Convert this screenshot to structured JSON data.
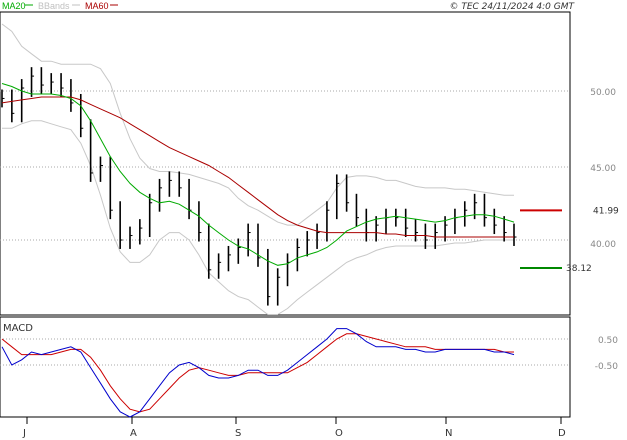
{
  "legend": {
    "ma20": "MA20",
    "bbands": "BBands",
    "ma60": "MA60"
  },
  "copyright": "© TEC 24/11/2024 4:0 GMT",
  "macd_label": "MACD",
  "colors": {
    "ma20": "#00aa00",
    "ma60": "#aa0000",
    "bbands": "#c8c8c8",
    "macd": "#0000cc",
    "signal": "#cc0000",
    "bars": "#000000",
    "resistance": "#cc0000",
    "support": "#008800"
  },
  "chart_data": [
    {
      "type": "line",
      "title": "",
      "price_axis_labels": [
        "50.00",
        "45.00",
        "40.00"
      ],
      "month_labels": [
        "J",
        "A",
        "S",
        "O",
        "N",
        "D"
      ],
      "ylim": [
        34,
        55
      ],
      "levels": {
        "resistance": {
          "label": "41.99",
          "value": 41.99
        },
        "support": {
          "label": "38.12",
          "value": 38.12
        }
      },
      "dates_index": [
        0,
        2,
        4,
        6,
        8,
        10,
        12,
        14,
        16,
        18,
        20,
        22,
        24,
        26,
        28,
        30,
        32,
        34,
        36,
        38,
        40,
        42,
        44,
        46,
        48,
        50,
        52,
        54,
        56,
        58,
        60,
        62,
        64,
        66,
        68,
        70,
        72,
        74,
        76,
        78,
        80,
        82,
        84,
        86,
        88,
        90,
        92,
        94,
        96,
        98,
        100,
        102,
        104
      ],
      "price": [
        49.5,
        48.5,
        50.2,
        51.0,
        50.4,
        50.6,
        50.2,
        49.2,
        47.5,
        44.5,
        45.0,
        42.0,
        40.0,
        40.3,
        40.8,
        42.5,
        43.5,
        44.0,
        43.5,
        42.0,
        40.5,
        38.0,
        38.5,
        39.0,
        39.5,
        40.5,
        38.8,
        36.2,
        37.5,
        38.5,
        39.5,
        40.0,
        40.5,
        42.0,
        43.8,
        42.5,
        41.5,
        40.5,
        41.0,
        41.5,
        41.5,
        40.8,
        40.5,
        40.0,
        40.5,
        41.0,
        41.5,
        42.0,
        42.5,
        41.5,
        41.0,
        40.5,
        40.2
      ],
      "ma20": [
        50.5,
        50.3,
        50.0,
        49.8,
        49.8,
        49.8,
        49.7,
        49.5,
        49.0,
        48.0,
        46.8,
        45.6,
        44.6,
        43.8,
        43.2,
        42.8,
        42.5,
        42.6,
        42.4,
        42.0,
        41.6,
        41.0,
        40.5,
        40.0,
        39.6,
        39.4,
        39.0,
        38.6,
        38.3,
        38.4,
        38.8,
        39.0,
        39.2,
        39.5,
        40.0,
        40.6,
        40.9,
        41.2,
        41.4,
        41.5,
        41.6,
        41.5,
        41.4,
        41.3,
        41.2,
        41.3,
        41.5,
        41.6,
        41.7,
        41.7,
        41.6,
        41.4,
        41.2
      ],
      "ma60": [
        49.2,
        49.3,
        49.4,
        49.5,
        49.6,
        49.6,
        49.6,
        49.6,
        49.4,
        49.1,
        48.8,
        48.5,
        48.2,
        47.8,
        47.4,
        47.0,
        46.6,
        46.2,
        45.9,
        45.6,
        45.3,
        45.0,
        44.6,
        44.2,
        43.7,
        43.2,
        42.7,
        42.2,
        41.7,
        41.3,
        41.0,
        40.8,
        40.6,
        40.5,
        40.5,
        40.5,
        40.5,
        40.5,
        40.5,
        40.4,
        40.4,
        40.3,
        40.3,
        40.3,
        40.2,
        40.2,
        40.2,
        40.2,
        40.2,
        40.2,
        40.2,
        40.2,
        40.2
      ],
      "bb_upper": [
        54.5,
        54.0,
        53.0,
        52.5,
        52.0,
        52.0,
        51.8,
        51.8,
        51.8,
        51.8,
        51.5,
        50.5,
        48.5,
        46.8,
        45.5,
        44.8,
        44.6,
        44.6,
        44.5,
        44.4,
        44.2,
        44.0,
        43.8,
        43.5,
        42.8,
        42.3,
        42.0,
        41.6,
        41.2,
        41.0,
        41.0,
        41.5,
        42.0,
        42.5,
        43.5,
        44.2,
        44.3,
        44.3,
        44.2,
        44.0,
        44.0,
        43.8,
        43.6,
        43.5,
        43.5,
        43.5,
        43.4,
        43.4,
        43.3,
        43.2,
        43.1,
        43.0,
        43.0
      ],
      "bb_lower": [
        47.5,
        47.5,
        47.8,
        48.0,
        48.0,
        47.8,
        47.6,
        47.4,
        46.5,
        45.0,
        43.0,
        40.8,
        39.2,
        38.5,
        38.5,
        39.0,
        40.0,
        40.5,
        40.5,
        40.0,
        39.0,
        37.8,
        37.2,
        36.6,
        36.2,
        36.0,
        35.5,
        35.0,
        35.0,
        35.4,
        36.0,
        36.5,
        37.0,
        37.5,
        38.0,
        38.5,
        38.8,
        39.0,
        39.3,
        39.5,
        39.6,
        39.6,
        39.6,
        39.6,
        39.6,
        39.7,
        39.8,
        39.8,
        39.9,
        40.0,
        40.0,
        40.0,
        40.0
      ]
    },
    {
      "type": "line",
      "title": "MACD",
      "axis_labels": [
        "0.50",
        "-0.50"
      ],
      "ylim": [
        -2.6,
        1.3
      ],
      "series": [
        {
          "name": "",
          "values": [
            0.2,
            -0.5,
            -0.3,
            0.0,
            -0.1,
            0.0,
            0.1,
            0.2,
            0.0,
            -0.6,
            -1.2,
            -1.8,
            -2.3,
            -2.5,
            -2.3,
            -1.8,
            -1.3,
            -0.8,
            -0.5,
            -0.4,
            -0.6,
            -0.9,
            -1.0,
            -1.0,
            -0.9,
            -0.7,
            -0.7,
            -0.9,
            -0.9,
            -0.7,
            -0.4,
            -0.1,
            0.2,
            0.5,
            0.9,
            0.9,
            0.7,
            0.4,
            0.2,
            0.2,
            0.2,
            0.1,
            0.1,
            0.0,
            0.0,
            0.1,
            0.1,
            0.1,
            0.1,
            0.1,
            0.0,
            0.0,
            -0.1
          ]
        },
        {
          "name": "",
          "values": [
            0.5,
            0.2,
            -0.1,
            -0.1,
            -0.1,
            -0.1,
            0.0,
            0.1,
            0.1,
            -0.2,
            -0.7,
            -1.3,
            -1.8,
            -2.2,
            -2.3,
            -2.2,
            -1.8,
            -1.4,
            -1.0,
            -0.7,
            -0.6,
            -0.7,
            -0.8,
            -0.9,
            -0.9,
            -0.8,
            -0.8,
            -0.8,
            -0.8,
            -0.8,
            -0.6,
            -0.4,
            -0.1,
            0.2,
            0.5,
            0.7,
            0.7,
            0.6,
            0.5,
            0.4,
            0.3,
            0.2,
            0.2,
            0.2,
            0.1,
            0.1,
            0.1,
            0.1,
            0.1,
            0.1,
            0.1,
            0.0,
            0.0
          ]
        }
      ]
    }
  ]
}
